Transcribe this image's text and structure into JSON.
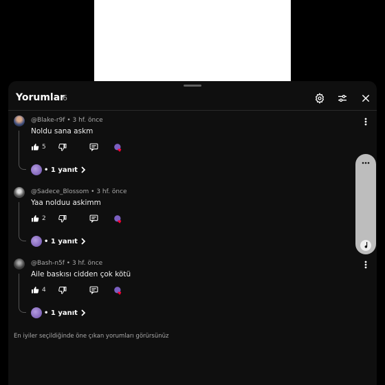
{
  "sheet": {
    "title": "Yorumlar",
    "count": "6",
    "icons": [
      "gear-icon",
      "filter-sliders-icon",
      "close-icon"
    ]
  },
  "comments": [
    {
      "author": "@Blake-r9f",
      "time": "3 hf. önce",
      "text": "Noldu sana askm",
      "likes": "5",
      "replies_label": "• 1 yanıt"
    },
    {
      "author": "@Sadece_Blossom",
      "time": "3 hf. önce",
      "text": "Yaa nolduu askimm",
      "likes": "2",
      "replies_label": "• 1 yanıt"
    },
    {
      "author": "@Bash-n5f",
      "time": "3 hf. önce",
      "text": "Aile baskısı cidden çok kötü",
      "likes": "4",
      "replies_label": "• 1 yanıt"
    }
  ],
  "footer_note": "En iyiler seçildiğinde öne çıkan yorumları görürsünüz",
  "colors": {
    "background": "#0f0f0f",
    "text_secondary": "#aaaaaa",
    "heart_badge": "#ff0033"
  }
}
